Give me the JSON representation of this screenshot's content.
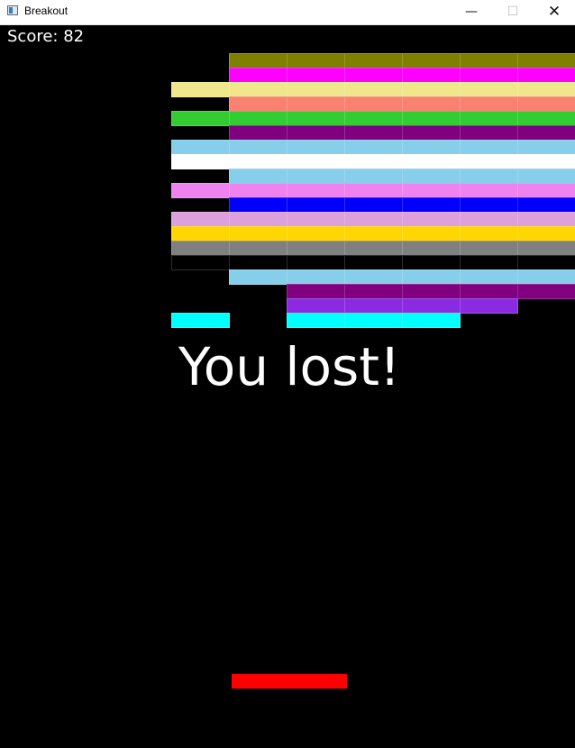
{
  "window": {
    "title": "Breakout",
    "controls": {
      "minimize": "—",
      "maximize": "☐",
      "close": "✕"
    }
  },
  "game": {
    "score_text": "Score: 82",
    "message": "You lost!",
    "paddle_color": "#ff0000",
    "brick_grid": {
      "columns": 7,
      "rows": [
        {
          "color": "#808000",
          "cols": [
            1,
            2,
            3,
            4,
            5,
            6
          ]
        },
        {
          "color": "#ff00ff",
          "cols": [
            1,
            2,
            3,
            4,
            5,
            6
          ]
        },
        {
          "color": "#f0e68c",
          "cols": [
            0,
            1,
            2,
            3,
            4,
            5,
            6
          ]
        },
        {
          "color": "#fa8072",
          "cols": [
            1,
            2,
            3,
            4,
            5,
            6
          ]
        },
        {
          "color": "#32cd32",
          "cols": [
            0,
            1,
            2,
            3,
            4,
            5,
            6
          ]
        },
        {
          "color": "#800080",
          "cols": [
            1,
            2,
            3,
            4,
            5,
            6
          ]
        },
        {
          "color": "#87ceeb",
          "cols": [
            0,
            1,
            2,
            3,
            4,
            5,
            6
          ]
        },
        {
          "color": "#ffffff",
          "cols": [
            0,
            1,
            2,
            3,
            4,
            5,
            6
          ]
        },
        {
          "color": "#87ceeb",
          "cols": [
            1,
            2,
            3,
            4,
            5,
            6
          ]
        },
        {
          "color": "#ee82ee",
          "cols": [
            0,
            1,
            2,
            3,
            4,
            5,
            6
          ]
        },
        {
          "color": "#0000ff",
          "cols": [
            1,
            2,
            3,
            4,
            5,
            6
          ]
        },
        {
          "color": "#dda0dd",
          "cols": [
            0,
            1,
            2,
            3,
            4,
            5,
            6
          ]
        },
        {
          "color": "#ffd700",
          "cols": [
            0,
            1,
            2,
            3,
            4,
            5,
            6
          ]
        },
        {
          "color": "#808080",
          "cols": [
            0,
            1,
            2,
            3,
            4,
            5,
            6
          ]
        },
        {
          "color": "#000000",
          "cols": [
            0,
            1,
            2,
            3,
            4,
            5,
            6
          ]
        },
        {
          "color": "#87ceeb",
          "cols": [
            1,
            2,
            3,
            4,
            5,
            6
          ]
        },
        {
          "color": "#800080",
          "cols": [
            2,
            3,
            4,
            5,
            6
          ]
        },
        {
          "color": "#8a2be2",
          "cols": [
            2,
            3,
            4,
            5
          ]
        },
        {
          "color": "#00ffff",
          "cols": [
            0,
            2,
            3,
            4
          ]
        }
      ]
    }
  }
}
